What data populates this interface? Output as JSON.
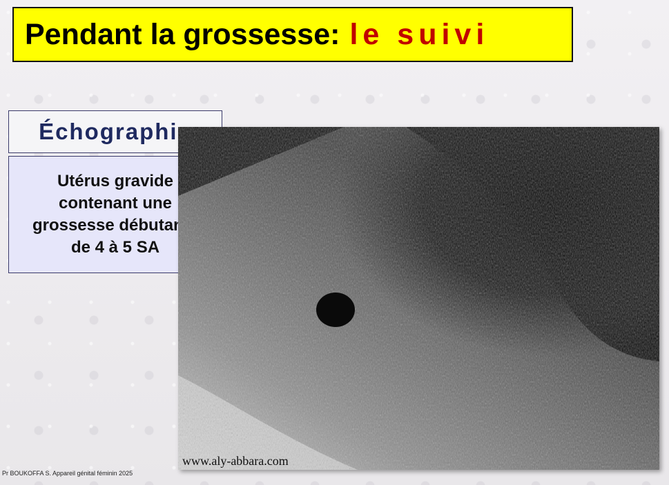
{
  "slide": {
    "title_main": "Pendant la grossesse:",
    "title_accent": "le suivi",
    "section_label": "Échographie",
    "description_lines": [
      "Utérus gravide",
      "contenant une",
      "grossesse débutante",
      "de 4 à 5 SA"
    ],
    "image_watermark": "www.aly-abbara.com",
    "footer": "Pr BOUKOFFA S. Appareil génital féminin 2025"
  },
  "colors": {
    "title_bg": "#ffff00",
    "title_accent": "#c00000",
    "label_text": "#1f2a60",
    "description_bg": "#e6e6fa"
  }
}
